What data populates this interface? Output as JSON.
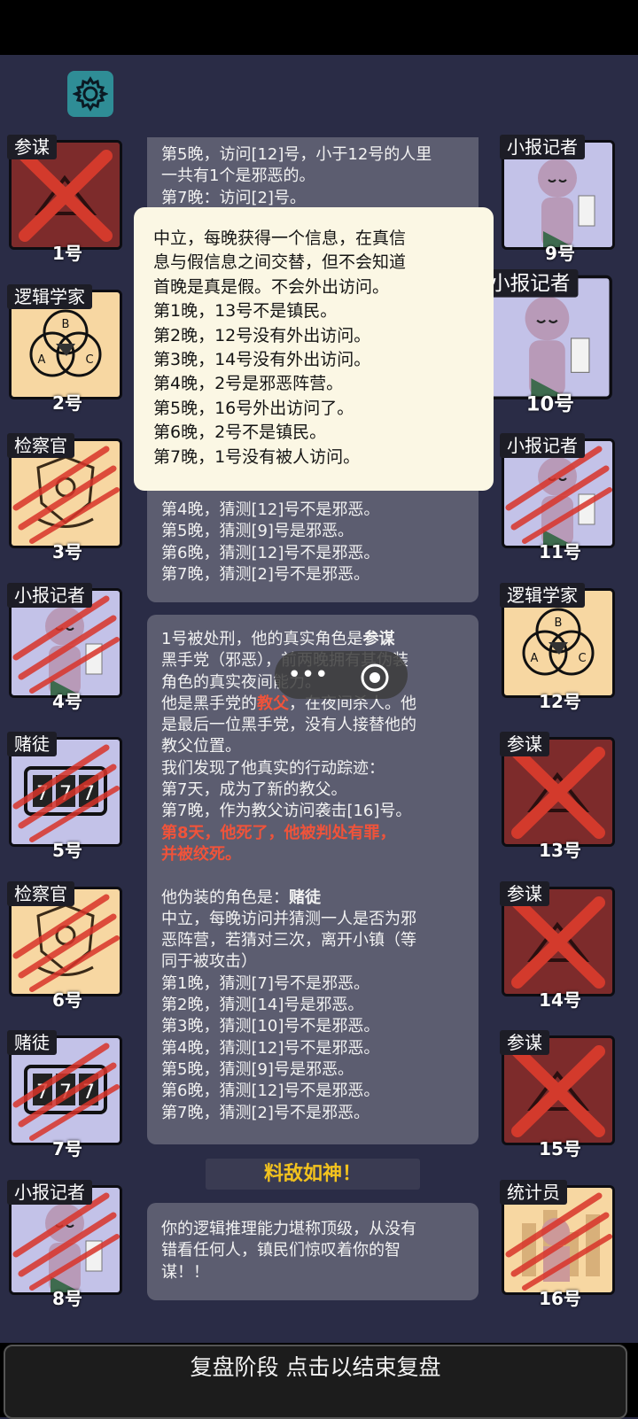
{
  "settings_icon": "gear-icon",
  "left_cards": [
    {
      "role": "参谋",
      "num": "1号",
      "portrait": "cross-icon",
      "bg": "#7d2b2b",
      "dead": "cross"
    },
    {
      "role": "逻辑学家",
      "num": "2号",
      "portrait": "venn-icon",
      "bg": "#f7d7a2",
      "dead": "none"
    },
    {
      "role": "检察官",
      "num": "3号",
      "portrait": "shield-icon",
      "bg": "#f7d7a2",
      "dead": "claw"
    },
    {
      "role": "小报记者",
      "num": "4号",
      "portrait": "person-icon",
      "bg": "#c3c2e8",
      "dead": "claw"
    },
    {
      "role": "赌徒",
      "num": "5号",
      "portrait": "slot-icon",
      "bg": "#c3c2e8",
      "dead": "claw"
    },
    {
      "role": "检察官",
      "num": "6号",
      "portrait": "shield-icon",
      "bg": "#f7d7a2",
      "dead": "claw"
    },
    {
      "role": "赌徒",
      "num": "7号",
      "portrait": "slot-icon",
      "bg": "#c3c2e8",
      "dead": "claw"
    },
    {
      "role": "小报记者",
      "num": "8号",
      "portrait": "person-icon",
      "bg": "#c3c2e8",
      "dead": "claw"
    }
  ],
  "right_cards": [
    {
      "role": "小报记者",
      "num": "9号",
      "portrait": "person-icon",
      "bg": "#c3c2e8",
      "dead": "none"
    },
    {
      "role": "小报记者",
      "num": "10号",
      "portrait": "person-icon",
      "bg": "#c3c2e8",
      "dead": "none"
    },
    {
      "role": "小报记者",
      "num": "11号",
      "portrait": "person-icon",
      "bg": "#c3c2e8",
      "dead": "claw"
    },
    {
      "role": "逻辑学家",
      "num": "12号",
      "portrait": "venn-icon",
      "bg": "#f7d7a2",
      "dead": "none"
    },
    {
      "role": "参谋",
      "num": "13号",
      "portrait": "cross-icon",
      "bg": "#7d2b2b",
      "dead": "cross"
    },
    {
      "role": "参谋",
      "num": "14号",
      "portrait": "cross-icon",
      "bg": "#7d2b2b",
      "dead": "cross"
    },
    {
      "role": "参谋",
      "num": "15号",
      "portrait": "cross-icon",
      "bg": "#7d2b2b",
      "dead": "cross"
    },
    {
      "role": "统计员",
      "num": "16号",
      "portrait": "chart-icon",
      "bg": "#f7d7a2",
      "dead": "claw"
    }
  ],
  "panel1_lines": [
    "第5晚，访问[12]号，小于12号的人里",
    "一共有1个是邪恶的。",
    "第7晚：访问[2]号。"
  ],
  "panel2_lines": [
    "第4晚，猜测[12]号不是邪恶。",
    "第5晚，猜测[9]号是邪恶。",
    "第6晚，猜测[12]号不是邪恶。",
    "第7晚，猜测[2]号不是邪恶。"
  ],
  "popup_lines": [
    "中立，每晚获得一个信息，在真信",
    "息与假信息之间交替，但不会知道",
    "首晚是真是假。不会外出访问。",
    "第1晚，13号不是镇民。",
    "第2晚，12号没有外出访问。",
    "第3晚，14号没有外出访问。",
    "第4晚，2号是邪恶阵营。",
    "第5晚，16号外出访问了。",
    "第6晚，2号不是镇民。",
    "第7晚，1号没有被人访问。"
  ],
  "panel3": {
    "intro_a": "1号被处刑，他的真实角色是",
    "intro_role": "参谋",
    "line2": "黑手党（邪恶），前两晚拥有其伪装",
    "line3": "角色的真实夜间能力。",
    "line4_a": "他是黑手党的",
    "line4_role": "教父",
    "line4_b": "，在夜间杀人。他",
    "line5": "是最后一位黑手党，没有人接替他的",
    "line6": "教父位置。",
    "line7": "我们发现了他真实的行动踪迹：",
    "line8": "第7天，成为了新的教父。",
    "line9": "第7晚，作为教父访问袭击[16]号。",
    "red1": "第8天，他死了，他被判处有罪，",
    "red2": "并被绞死。",
    "disguise_a": "他伪装的角色是：",
    "disguise_role": "赌徒",
    "desc": [
      "中立，每晚访问并猜测一人是否为邪",
      "恶阵营，若猜对三次，离开小镇（等",
      "同于被攻击）",
      "第1晚，猜测[7]号不是邪恶。",
      "第2晚，猜测[14]号是邪恶。",
      "第3晚，猜测[10]号不是邪恶。",
      "第4晚，猜测[12]号不是邪恶。",
      "第5晚，猜测[9]号是邪恶。",
      "第6晚，猜测[12]号不是邪恶。",
      "第7晚，猜测[2]号不是邪恶。"
    ]
  },
  "banner": "料敌如神！",
  "verdict_lines": [
    "你的逻辑推理能力堪称顶级，从没有",
    "错看任何人，镇民们惊叹着你的智",
    "谋！！"
  ],
  "bottom_button": "复盘阶段 点击以结束复盘",
  "capsule_icons": [
    "more-icon",
    "target-icon"
  ]
}
